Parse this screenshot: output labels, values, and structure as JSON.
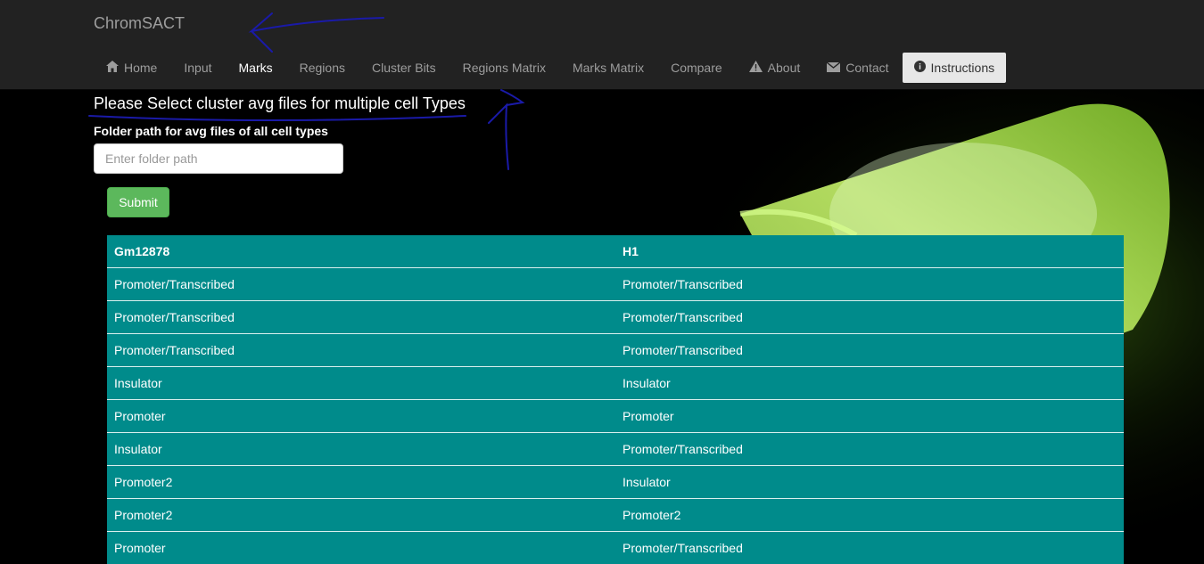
{
  "brand": "ChromSACT",
  "nav": {
    "items": [
      {
        "label": "Home",
        "icon": "home-icon"
      },
      {
        "label": "Input"
      },
      {
        "label": "Marks",
        "active": true
      },
      {
        "label": "Regions"
      },
      {
        "label": "Cluster Bits"
      },
      {
        "label": "Regions Matrix"
      },
      {
        "label": "Marks Matrix"
      },
      {
        "label": "Compare"
      },
      {
        "label": "About",
        "icon": "warning-icon"
      },
      {
        "label": "Contact",
        "icon": "envelope-icon"
      },
      {
        "label": "Instructions",
        "icon": "info-icon"
      }
    ]
  },
  "form": {
    "heading": "Please Select cluster avg files for multiple cell Types",
    "label": "Folder path for avg files of all cell types",
    "placeholder": "Enter folder path",
    "value": "",
    "submit": "Submit"
  },
  "table": {
    "headers": [
      "Gm12878",
      "H1"
    ],
    "rows": [
      [
        "Promoter/Transcribed",
        "Promoter/Transcribed"
      ],
      [
        "Promoter/Transcribed",
        "Promoter/Transcribed"
      ],
      [
        "Promoter/Transcribed",
        "Promoter/Transcribed"
      ],
      [
        "Insulator",
        "Insulator"
      ],
      [
        "Promoter",
        "Promoter"
      ],
      [
        "Insulator",
        "Promoter/Transcribed"
      ],
      [
        "Promoter2",
        "Insulator"
      ],
      [
        "Promoter2",
        "Promoter2"
      ],
      [
        "Promoter",
        "Promoter/Transcribed"
      ]
    ],
    "background": "#008b8b"
  },
  "colors": {
    "navbar": "#222222",
    "submit": "#5cb85c",
    "annotation_ink": "#1a1aa8"
  }
}
